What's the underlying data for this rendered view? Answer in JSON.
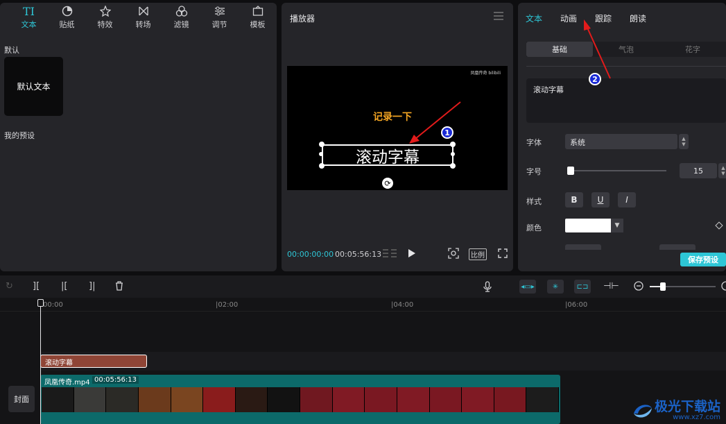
{
  "left_panel": {
    "tabs": [
      {
        "label": "文本",
        "icon": "text-icon",
        "active": true
      },
      {
        "label": "贴纸",
        "icon": "sticker-icon"
      },
      {
        "label": "特效",
        "icon": "effects-icon"
      },
      {
        "label": "转场",
        "icon": "transition-icon"
      },
      {
        "label": "滤镜",
        "icon": "filter-icon"
      },
      {
        "label": "调节",
        "icon": "adjust-icon"
      },
      {
        "label": "模板",
        "icon": "template-icon"
      }
    ],
    "default_label": "默认",
    "default_card": "默认文本",
    "my_presets_label": "我的预设"
  },
  "player": {
    "title": "播放器",
    "watermark": "凤凰传奇 bilibili",
    "overlay_text": "记录一下",
    "subtitle_text": "滚动字幕",
    "current_time": "00:00:00:00",
    "total_time": "00:05:56:13",
    "ratio_label": "比例",
    "badge1": "1"
  },
  "right_panel": {
    "tabs": [
      "文本",
      "动画",
      "跟踪",
      "朗读"
    ],
    "segments": [
      "基础",
      "气泡",
      "花字"
    ],
    "text_value": "滚动字幕",
    "font_label": "字体",
    "font_value": "系统",
    "size_label": "字号",
    "size_value": "15",
    "size_fraction": 0.05,
    "style_label": "样式",
    "style_buttons": [
      "B",
      "U",
      "I"
    ],
    "color_label": "颜色",
    "color_value": "#ffffff",
    "save_preset": "保存预设",
    "badge2": "2"
  },
  "timeline": {
    "ruler": [
      "00:00",
      "02:00",
      "04:00",
      "06:00"
    ],
    "text_clip": "滚动字幕",
    "video_clip_name": "凤凰传奇.mp4",
    "video_clip_duration": "00:05:56:13",
    "cover_label": "封面",
    "thumb_colors": [
      "#1a1a1a",
      "#3a3a38",
      "#2b2a26",
      "#6b3a1c",
      "#7a4520",
      "#8a1c1c",
      "#2a1a14",
      "#121212",
      "#701820",
      "#801a24",
      "#7a1822",
      "#801a24",
      "#7a1822",
      "#801a24",
      "#781820",
      "#1c1c1c"
    ]
  },
  "branding": {
    "logo_text": "极光下载站",
    "logo_sub": "www.xz7.com"
  },
  "colors": {
    "accent": "#2ec6d6",
    "annotation_red": "#e31b1b",
    "badge_blue": "#1a2ad6"
  }
}
